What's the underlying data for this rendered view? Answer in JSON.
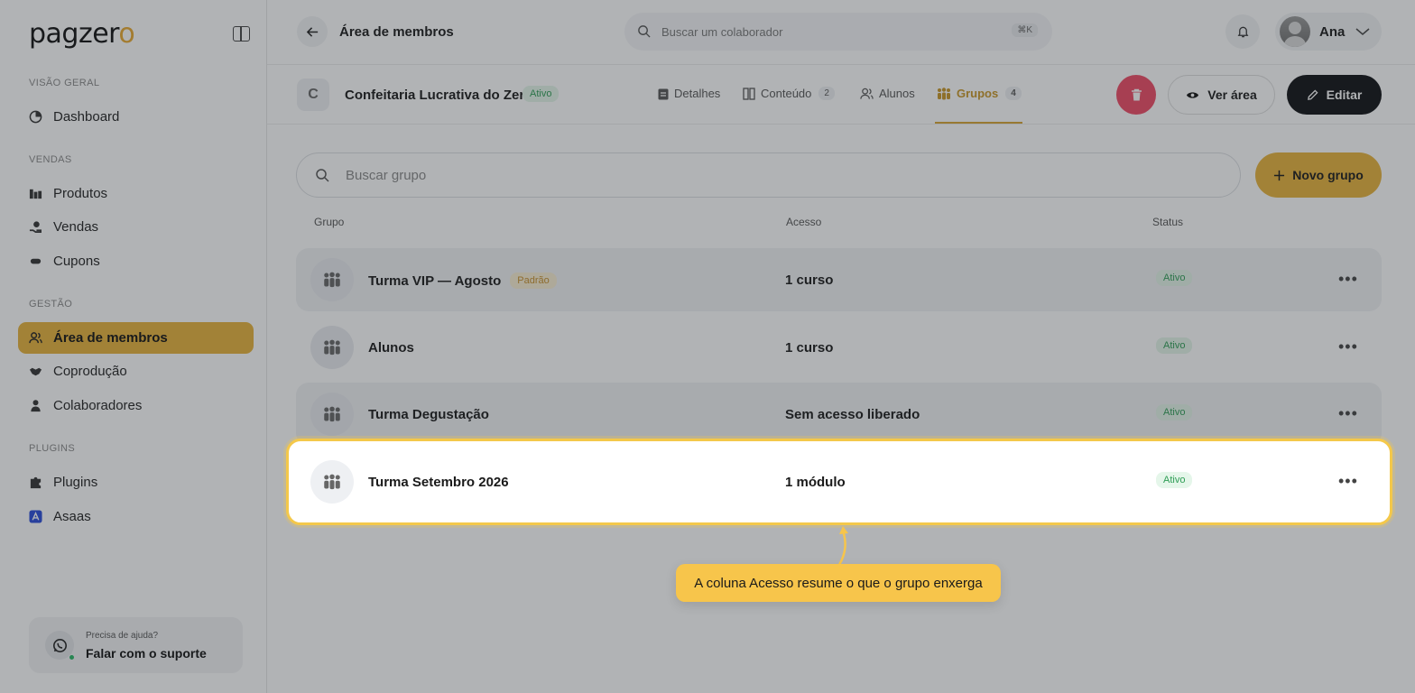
{
  "brand": {
    "logo_text": "pagzer",
    "logo_accent": "o",
    "accent_color": "#e8b33b"
  },
  "sidebar": {
    "sections": [
      {
        "label": "VISÃO GERAL"
      },
      {
        "label": "VENDAS"
      },
      {
        "label": "GESTÃO"
      },
      {
        "label": "PLUGINS"
      }
    ],
    "items": [
      {
        "label": "Dashboard",
        "icon": "dashboard-icon"
      },
      {
        "label": "Produtos",
        "icon": "products-icon"
      },
      {
        "label": "Vendas",
        "icon": "sales-icon"
      },
      {
        "label": "Cupons",
        "icon": "coupon-icon"
      },
      {
        "label": "Área de membros",
        "icon": "members-icon",
        "active": true
      },
      {
        "label": "Coprodução",
        "icon": "handshake-icon"
      },
      {
        "label": "Colaboradores",
        "icon": "user-icon"
      },
      {
        "label": "Plugins",
        "icon": "puzzle-icon"
      },
      {
        "label": "Asaas",
        "icon": "asaas-icon"
      }
    ],
    "help": {
      "question": "Precisa de ajuda?",
      "link": "Falar com o suporte"
    }
  },
  "topbar": {
    "title": "Área de membros",
    "search_placeholder": "Buscar um colaborador",
    "shortcut": "⌘K",
    "user_name": "Ana"
  },
  "product": {
    "initial": "C",
    "title": "Confeitaria Lucrativa do Zero",
    "status": "Ativo",
    "tabs": [
      {
        "label": "Detalhes",
        "count": ""
      },
      {
        "label": "Conteúdo",
        "count": "2"
      },
      {
        "label": "Alunos",
        "count": ""
      },
      {
        "label": "Grupos",
        "count": "4",
        "active": true
      }
    ],
    "view_label": "Ver área",
    "edit_label": "Editar"
  },
  "groups": {
    "search_placeholder": "Buscar grupo",
    "new_label": "Novo grupo",
    "columns": [
      "Grupo",
      "Acesso",
      "Status"
    ],
    "rows": [
      {
        "name": "Turma VIP — Agosto",
        "badge": "Padrão",
        "access": "1 curso",
        "status": "Ativo"
      },
      {
        "name": "Alunos",
        "badge": "",
        "access": "1 curso",
        "status": "Ativo"
      },
      {
        "name": "Turma Degustação",
        "badge": "",
        "access": "Sem acesso liberado",
        "status": "Ativo"
      },
      {
        "name": "Turma Setembro 2026",
        "badge": "",
        "access": "1 módulo",
        "status": "Ativo"
      }
    ]
  },
  "tour": {
    "tooltip": "A coluna Acesso resume o que o grupo enxerga"
  }
}
